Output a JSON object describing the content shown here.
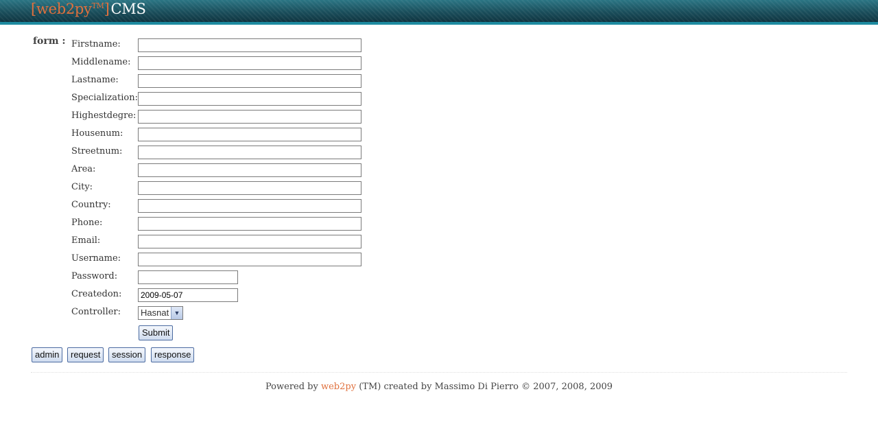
{
  "header": {
    "brand": "[web2py",
    "tm": "TM",
    "brand_close": "]",
    "app_name": "CMS"
  },
  "form": {
    "section_label": "form :",
    "fields": [
      {
        "label": "Firstname:",
        "value": ""
      },
      {
        "label": "Middlename:",
        "value": ""
      },
      {
        "label": "Lastname:",
        "value": ""
      },
      {
        "label": "Specialization:",
        "value": ""
      },
      {
        "label": "Highestdegre:",
        "value": ""
      },
      {
        "label": "Housenum:",
        "value": ""
      },
      {
        "label": "Streetnum:",
        "value": ""
      },
      {
        "label": "Area:",
        "value": ""
      },
      {
        "label": "City:",
        "value": ""
      },
      {
        "label": "Country:",
        "value": ""
      },
      {
        "label": "Phone:",
        "value": ""
      },
      {
        "label": "Email:",
        "value": ""
      },
      {
        "label": "Username:",
        "value": ""
      },
      {
        "label": "Password:",
        "value": ""
      },
      {
        "label": "Createdon:",
        "value": "2009-05-07"
      },
      {
        "label": "Controller:",
        "value": "Hasnat"
      }
    ],
    "submit_label": "Submit"
  },
  "debug_buttons": [
    "admin",
    "request",
    "session",
    "response"
  ],
  "footer": {
    "prefix": "Powered by ",
    "link_text": "web2py",
    "suffix": " (TM) created by Massimo Di Pierro © 2007, 2008, 2009"
  },
  "colors": {
    "header_bg": "#1a4e5b",
    "header_stripe": "#1e8ba0",
    "accent": "#e0703d"
  }
}
